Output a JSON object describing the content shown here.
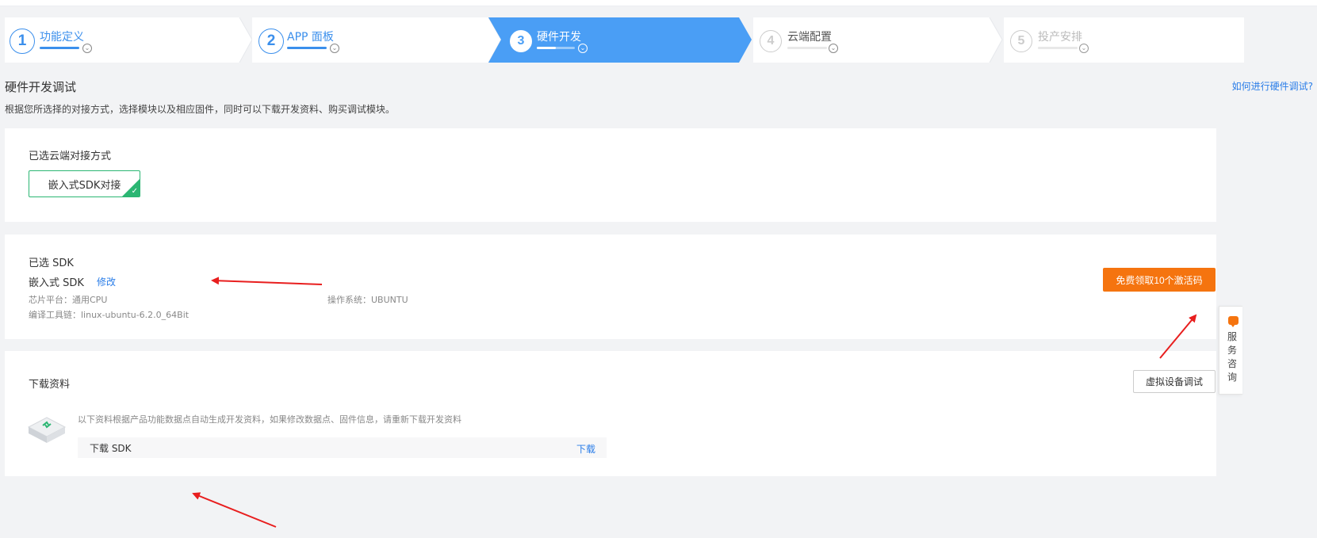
{
  "stepper": {
    "steps": [
      {
        "number": "1",
        "label": "功能定义"
      },
      {
        "number": "2",
        "label": "APP 面板"
      },
      {
        "number": "3",
        "label": "硬件开发"
      },
      {
        "number": "4",
        "label": "云端配置"
      },
      {
        "number": "5",
        "label": "投产安排"
      }
    ],
    "active_index": 2,
    "accent_color": "#4a9ef5"
  },
  "header": {
    "title": "硬件开发调试",
    "help_link": "如何进行硬件调试?",
    "description": "根据您所选择的对接方式，选择模块以及相应固件，同时可以下载开发资料、购买调试模块。"
  },
  "cloud_card": {
    "heading": "已选云端对接方式",
    "selected_option": "嵌入式SDK对接",
    "check_color": "#2bb673"
  },
  "sdk_card": {
    "heading": "已选 SDK",
    "sdk_name": "嵌入式 SDK",
    "modify_label": "修改",
    "chip_platform": "芯片平台：通用CPU",
    "os": "操作系统：UBUNTU",
    "toolchain": "编译工具链：linux-ubuntu-6.2.0_64Bit",
    "activate_button": "免费领取10个激活码",
    "button_color": "#f5740f"
  },
  "download_card": {
    "heading": "下载资料",
    "virtual_debug_button": "虚拟设备调试",
    "description": "以下资料根据产品功能数据点自动生成开发资料，如果修改数据点、固件信息，请重新下载开发资料",
    "rows": [
      {
        "name": "下载 SDK",
        "action": "下载"
      }
    ]
  },
  "float_service": {
    "icon": "chat-icon",
    "label": "服务咨询"
  }
}
